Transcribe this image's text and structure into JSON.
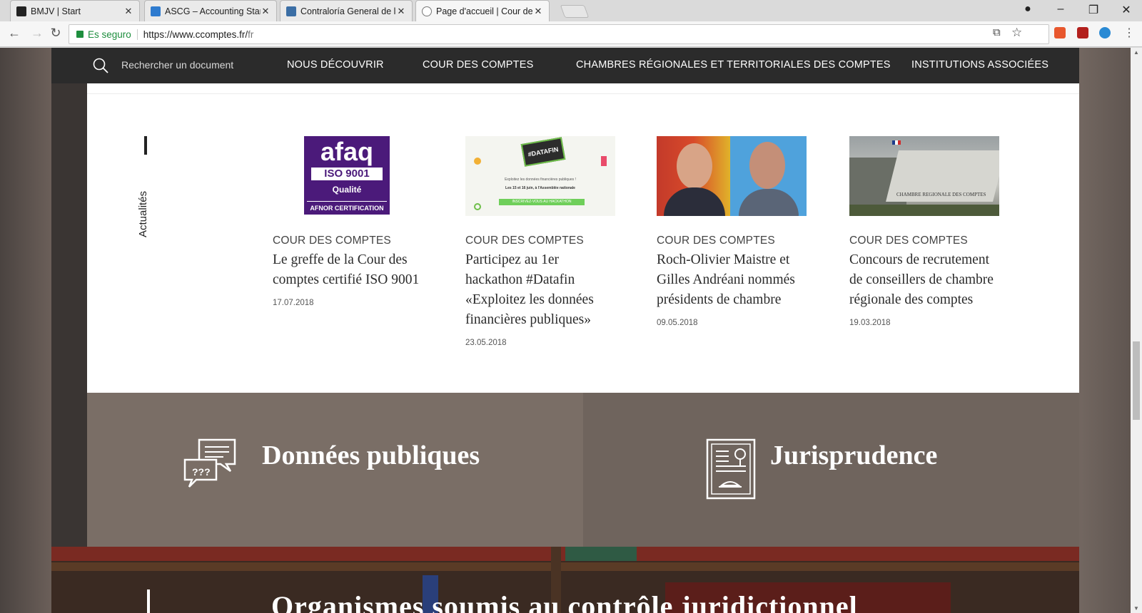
{
  "browser": {
    "tabs": [
      {
        "title": "BMJV | Start",
        "favicon_color": "#222222"
      },
      {
        "title": "ASCG – Accounting Stand",
        "favicon_color": "#2e7bcf"
      },
      {
        "title": "Contraloría General de la",
        "favicon_color": "#3b6ea5"
      },
      {
        "title": "Page d'accueil | Cour des",
        "favicon_color": "#777777"
      }
    ],
    "secure_label": "Es seguro",
    "url_main": "https://www.ccomptes.fr/",
    "url_path": "fr"
  },
  "site": {
    "search_placeholder": "Rechercher un document",
    "nav": [
      "NOUS DÉCOUVRIR",
      "COUR DES COMPTES",
      "CHAMBRES RÉGIONALES ET TERRITORIALES DES COMPTES",
      "INSTITUTIONS ASSOCIÉES"
    ],
    "section_label": "Actualités",
    "news": [
      {
        "category": "COUR DES COMPTES",
        "title": "Le greffe de la Cour des comptes certifié ISO 9001",
        "date": "17.07.2018",
        "image": {
          "line1": "afaq",
          "line2": "ISO 9001",
          "line3": "Qualité",
          "line4": "AFNOR CERTIFICATION"
        }
      },
      {
        "category": "COUR DES COMPTES",
        "title": "Participez au 1er hackathon #Datafin «Exploitez les données financières publiques»",
        "date": "23.05.2018",
        "image": {
          "badge": "#DATAFIN",
          "line1": "Exploitez les données financières publiques !",
          "line2": "Les 15 et 16 juin, à l'Assemblée nationale",
          "button": "INSCRIVEZ-VOUS AU HACKATHON"
        }
      },
      {
        "category": "COUR DES COMPTES",
        "title": "Roch-Olivier Maistre et Gilles Andréani nommés présidents de chambre",
        "date": "09.05.2018",
        "image": {}
      },
      {
        "category": "COUR DES COMPTES",
        "title": "Concours de recrutement de conseillers de chambre régionale des comptes",
        "date": "19.03.2018",
        "image": {
          "sign": "CHAMBRE REGIONALE DES COMPTES"
        }
      }
    ],
    "tiles": [
      {
        "title": "Données publiques",
        "icon_text": "???"
      },
      {
        "title": "Jurisprudence"
      }
    ],
    "bottom_heading": "Organismes soumis au contrôle juridictionnel"
  }
}
